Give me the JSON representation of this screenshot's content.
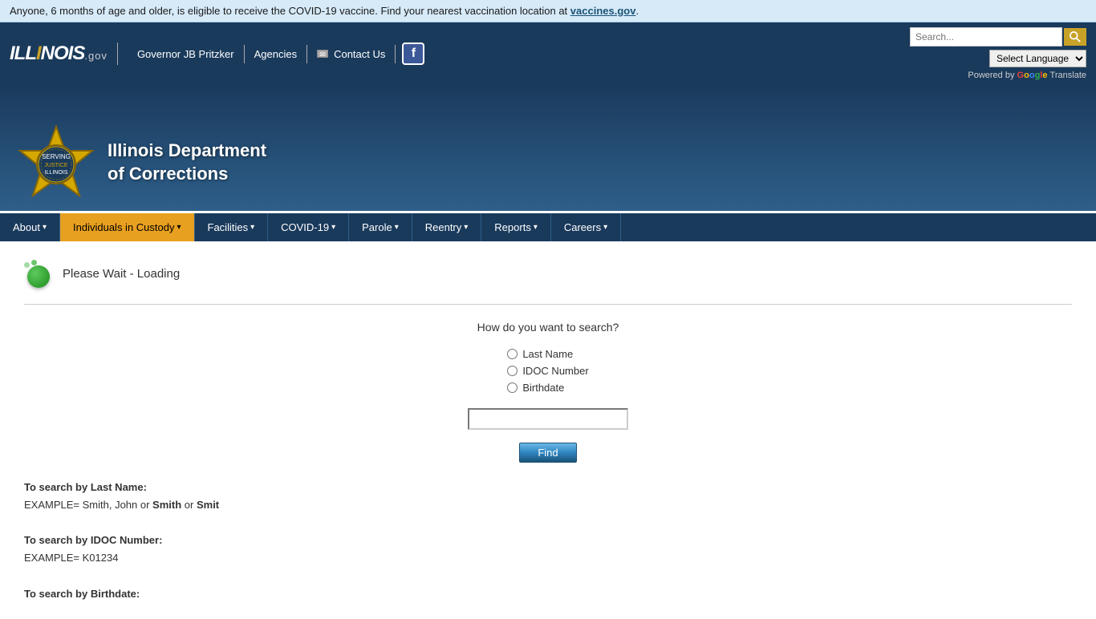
{
  "covid_banner": {
    "text": "Anyone, 6 months of age and older, is eligible to receive the COVID-19 vaccine. Find your nearest vaccination location at ",
    "link_text": "vaccines.gov",
    "link_url": "https://vaccines.gov"
  },
  "top_nav": {
    "logo_text": "ILL",
    "logo_highlight": "I",
    "logo_suffix": "NOIS",
    "logo_gov": ".gov",
    "links": [
      {
        "label": "Governor JB Pritzker",
        "id": "governor-link"
      },
      {
        "label": "Agencies",
        "id": "agencies-link"
      },
      {
        "label": "Contact Us",
        "id": "contact-link"
      }
    ],
    "search_placeholder": "Search...",
    "search_button_label": "Search",
    "language_label": "Select Language",
    "powered_by_text": "Powered by",
    "google_text": "Google",
    "translate_text": "Translate"
  },
  "site_header": {
    "dept_name_line1": "Illinois Department",
    "dept_name_line2": "of Corrections"
  },
  "main_nav": {
    "items": [
      {
        "label": "About",
        "id": "nav-about",
        "active": false
      },
      {
        "label": "Individuals in Custody",
        "id": "nav-individuals",
        "active": true
      },
      {
        "label": "Facilities",
        "id": "nav-facilities",
        "active": false
      },
      {
        "label": "COVID-19",
        "id": "nav-covid",
        "active": false
      },
      {
        "label": "Parole",
        "id": "nav-parole",
        "active": false
      },
      {
        "label": "Reentry",
        "id": "nav-reentry",
        "active": false
      },
      {
        "label": "Reports",
        "id": "nav-reports",
        "active": false
      },
      {
        "label": "Careers",
        "id": "nav-careers",
        "active": false
      }
    ]
  },
  "content": {
    "loading_text": "Please Wait - Loading",
    "search_question": "How do you want to search?",
    "radio_options": [
      {
        "label": "Last Name",
        "value": "last_name",
        "id": "radio-last-name"
      },
      {
        "label": "IDOC Number",
        "value": "idoc_number",
        "id": "radio-idoc"
      },
      {
        "label": "Birthdate",
        "value": "birthdate",
        "id": "radio-birthdate"
      }
    ],
    "find_button_label": "Find",
    "help_sections": [
      {
        "title": "To search by Last Name:",
        "example_label": "EXAMPLE= Smith, John",
        "or_text": "or",
        "bold_parts": [
          "Smith",
          "Smit"
        ],
        "full_example": "EXAMPLE= Smith, John or Smith or Smit"
      },
      {
        "title": "To search by IDOC Number:",
        "full_example": "EXAMPLE= K01234"
      },
      {
        "title": "To search by Birthdate:",
        "full_example": ""
      }
    ]
  }
}
